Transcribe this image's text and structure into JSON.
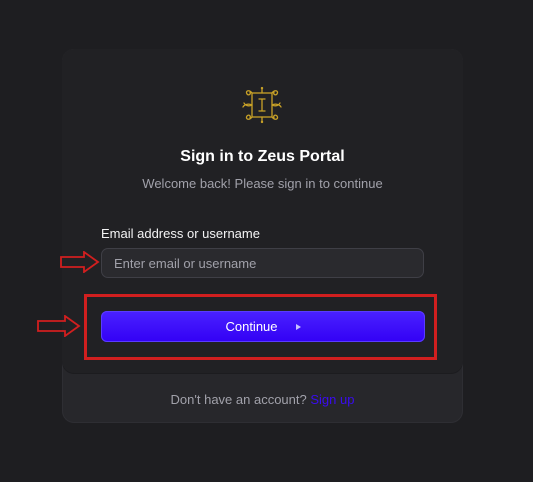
{
  "login": {
    "title": "Sign in to Zeus Portal",
    "subtitle": "Welcome back! Please sign in to continue",
    "email_label": "Email address or username",
    "email_placeholder": "Enter email or username",
    "email_value": "",
    "continue_label": "Continue",
    "footer_text": "Don't have an account?",
    "signup_label": "Sign up"
  },
  "icons": {
    "logo": "ornate-frame-logo-icon",
    "continue": "caret-right-icon",
    "annotation": "outlined-arrow-right-icon"
  },
  "colors": {
    "background": "#1e1e21",
    "card": "#212124",
    "footer": "#27272b",
    "primary": "#3a0cf0",
    "logo_gold": "#c9a227",
    "annotation_red": "#d11f1f"
  }
}
